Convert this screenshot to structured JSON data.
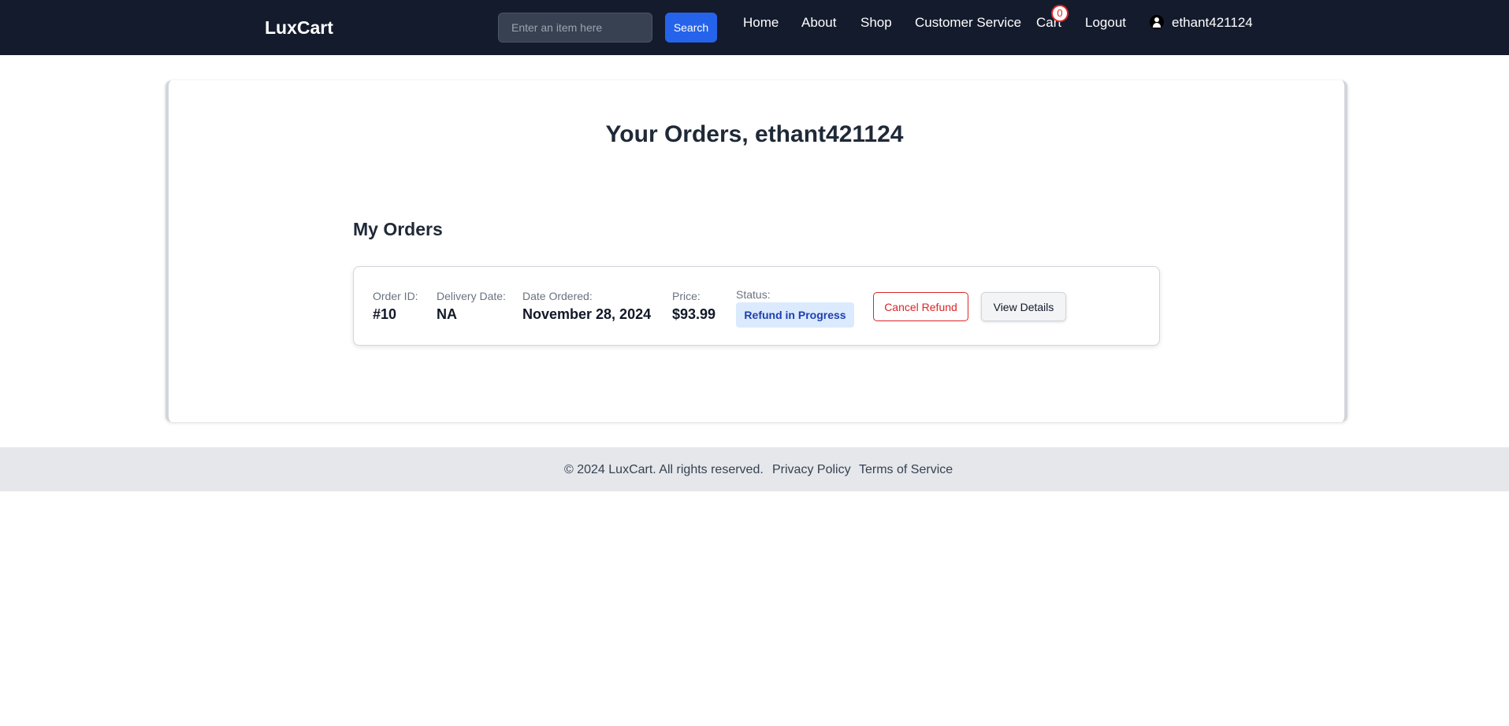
{
  "navbar": {
    "brand": "LuxCart",
    "search_placeholder": "Enter an item here",
    "search_button": "Search",
    "links": {
      "home": "Home",
      "about": "About",
      "shop": "Shop",
      "customer_service": "Customer Service",
      "cart": "Cart",
      "logout": "Logout"
    },
    "cart_count": "0",
    "username": "ethant421124"
  },
  "page": {
    "title": "Your Orders, ethant421124",
    "section_title": "My Orders"
  },
  "order": {
    "id_label": "Order ID:",
    "id_value": "#10",
    "delivery_label": "Delivery Date:",
    "delivery_value": "NA",
    "ordered_label": "Date Ordered:",
    "ordered_value": "November 28, 2024",
    "price_label": "Price:",
    "price_value": "$93.99",
    "status_label": "Status:",
    "status_value": "Refund in Progress",
    "cancel_button": "Cancel Refund",
    "details_button": "View Details"
  },
  "footer": {
    "copyright": "© 2024 LuxCart. All rights reserved.",
    "privacy": "Privacy Policy",
    "terms": "Terms of Service"
  },
  "colors": {
    "navbar_bg": "#141b2d",
    "accent": "#2563eb",
    "danger": "#dc2626",
    "status_bg": "#dbeafe",
    "status_text": "#1e40af",
    "footer_bg": "#e5e7eb"
  },
  "icons": {
    "user": "user-icon"
  }
}
